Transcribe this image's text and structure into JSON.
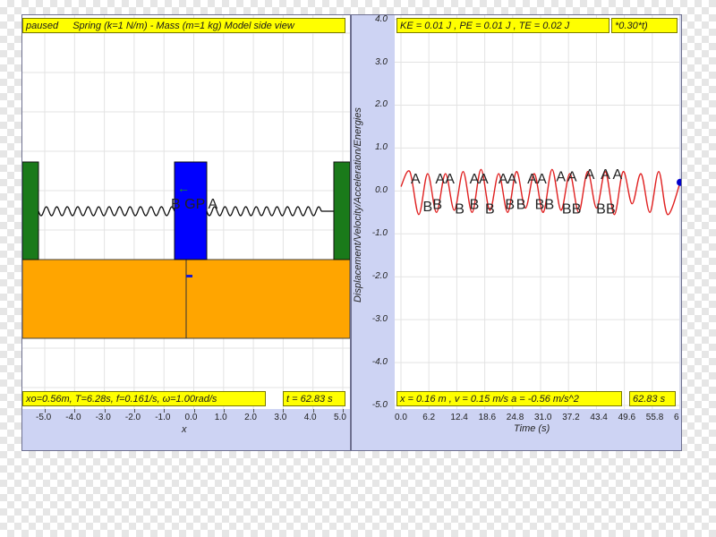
{
  "left": {
    "status_label": "paused",
    "title": "Spring (k=1 N/m) - Mass (m=1 kg) Model side view",
    "params": "xo=0.56m, T=6.28s, f=0.161/s, ω=1.00rad/s",
    "time": "t = 62.83 s",
    "xaxis_label": "x",
    "xticks": [
      "-5.0",
      "-4.0",
      "-3.0",
      "-2.0",
      "-1.0",
      "0.0",
      "1.0",
      "2.0",
      "3.0",
      "4.0",
      "5.0"
    ],
    "mass_label": "B GP A",
    "velocity_arrow": "←"
  },
  "right": {
    "energies": "KE = 0.01 J , PE = 0.01 J , TE = 0.02 J",
    "formula_fragment": "*0.30*t)",
    "readout": "x = 0.16 m , v = 0.15 m/s a = -0.56 m/s^2",
    "time": "62.83 s",
    "yaxis_label": "Displacement/Velocity/Acceleration/Energies",
    "xaxis_label": "Time (s)",
    "yticks": [
      "4.0",
      "3.0",
      "2.0",
      "1.0",
      "0.0",
      "-1.0",
      "-2.0",
      "-3.0",
      "-4.0",
      "-5.0"
    ],
    "xticks": [
      "0.0",
      "6.2",
      "12.4",
      "18.6",
      "24.8",
      "31.0",
      "37.2",
      "43.4",
      "49.6",
      "55.8",
      "6"
    ]
  },
  "chart_data": {
    "type": "line",
    "xlabel": "Time (s)",
    "ylabel": "Displacement/Velocity/Acceleration/Energies",
    "xlim": [
      0,
      62.83
    ],
    "ylim": [
      -5,
      4.5
    ],
    "series": [
      {
        "color": "#e02020",
        "x": [
          0,
          2,
          4,
          6,
          8,
          10,
          12,
          14,
          16,
          18,
          20,
          22,
          24,
          26,
          28,
          30,
          32,
          34,
          36,
          38,
          40,
          42,
          44,
          46,
          48,
          50,
          52,
          54,
          56,
          58,
          60,
          62.83
        ],
        "values": [
          0.1,
          0.45,
          -0.55,
          0.4,
          -0.5,
          0.4,
          -0.45,
          0.45,
          -0.5,
          0.5,
          -0.45,
          0.4,
          -0.5,
          0.45,
          -0.4,
          0.4,
          -0.5,
          0.5,
          -0.45,
          0.4,
          -0.5,
          0.45,
          -0.4,
          0.45,
          -0.55,
          0.45,
          -0.3,
          0.4,
          -0.5,
          0.45,
          -0.55,
          0.2
        ]
      }
    ],
    "markers": [
      {
        "label": "A",
        "x": 3.3,
        "y": 0.3
      },
      {
        "label": "B",
        "x": 6.0,
        "y": -0.35
      },
      {
        "label": "B",
        "x": 8.2,
        "y": -0.3
      },
      {
        "label": "A",
        "x": 8.8,
        "y": 0.3
      },
      {
        "label": "A",
        "x": 11.0,
        "y": 0.3
      },
      {
        "label": "B",
        "x": 13.2,
        "y": -0.4
      },
      {
        "label": "B",
        "x": 16.5,
        "y": -0.3
      },
      {
        "label": "A",
        "x": 16.5,
        "y": 0.3
      },
      {
        "label": "A",
        "x": 18.6,
        "y": 0.3
      },
      {
        "label": "B",
        "x": 20.0,
        "y": -0.4
      },
      {
        "label": "A",
        "x": 23.0,
        "y": 0.3
      },
      {
        "label": "A",
        "x": 25.0,
        "y": 0.3
      },
      {
        "label": "B",
        "x": 24.5,
        "y": -0.3
      },
      {
        "label": "B",
        "x": 27.0,
        "y": -0.3
      },
      {
        "label": "A",
        "x": 29.5,
        "y": 0.3
      },
      {
        "label": "A",
        "x": 31.7,
        "y": 0.3
      },
      {
        "label": "B",
        "x": 31.2,
        "y": -0.3
      },
      {
        "label": "B",
        "x": 33.4,
        "y": -0.3
      },
      {
        "label": "A",
        "x": 36.0,
        "y": 0.35
      },
      {
        "label": "A",
        "x": 38.5,
        "y": 0.35
      },
      {
        "label": "B",
        "x": 37.3,
        "y": -0.4
      },
      {
        "label": "B",
        "x": 39.5,
        "y": -0.4
      },
      {
        "label": "A",
        "x": 42.5,
        "y": 0.4
      },
      {
        "label": "A",
        "x": 46.0,
        "y": 0.4
      },
      {
        "label": "A",
        "x": 48.7,
        "y": 0.4
      },
      {
        "label": "B",
        "x": 45.0,
        "y": -0.4
      },
      {
        "label": "B",
        "x": 47.2,
        "y": -0.4
      }
    ]
  },
  "colors": {
    "panel": "#cdd3f3",
    "yellow": "#ffff00",
    "orange": "#ffa500",
    "green": "#1a7a1a",
    "mass": "#0000ff",
    "curve": "#e02020"
  }
}
